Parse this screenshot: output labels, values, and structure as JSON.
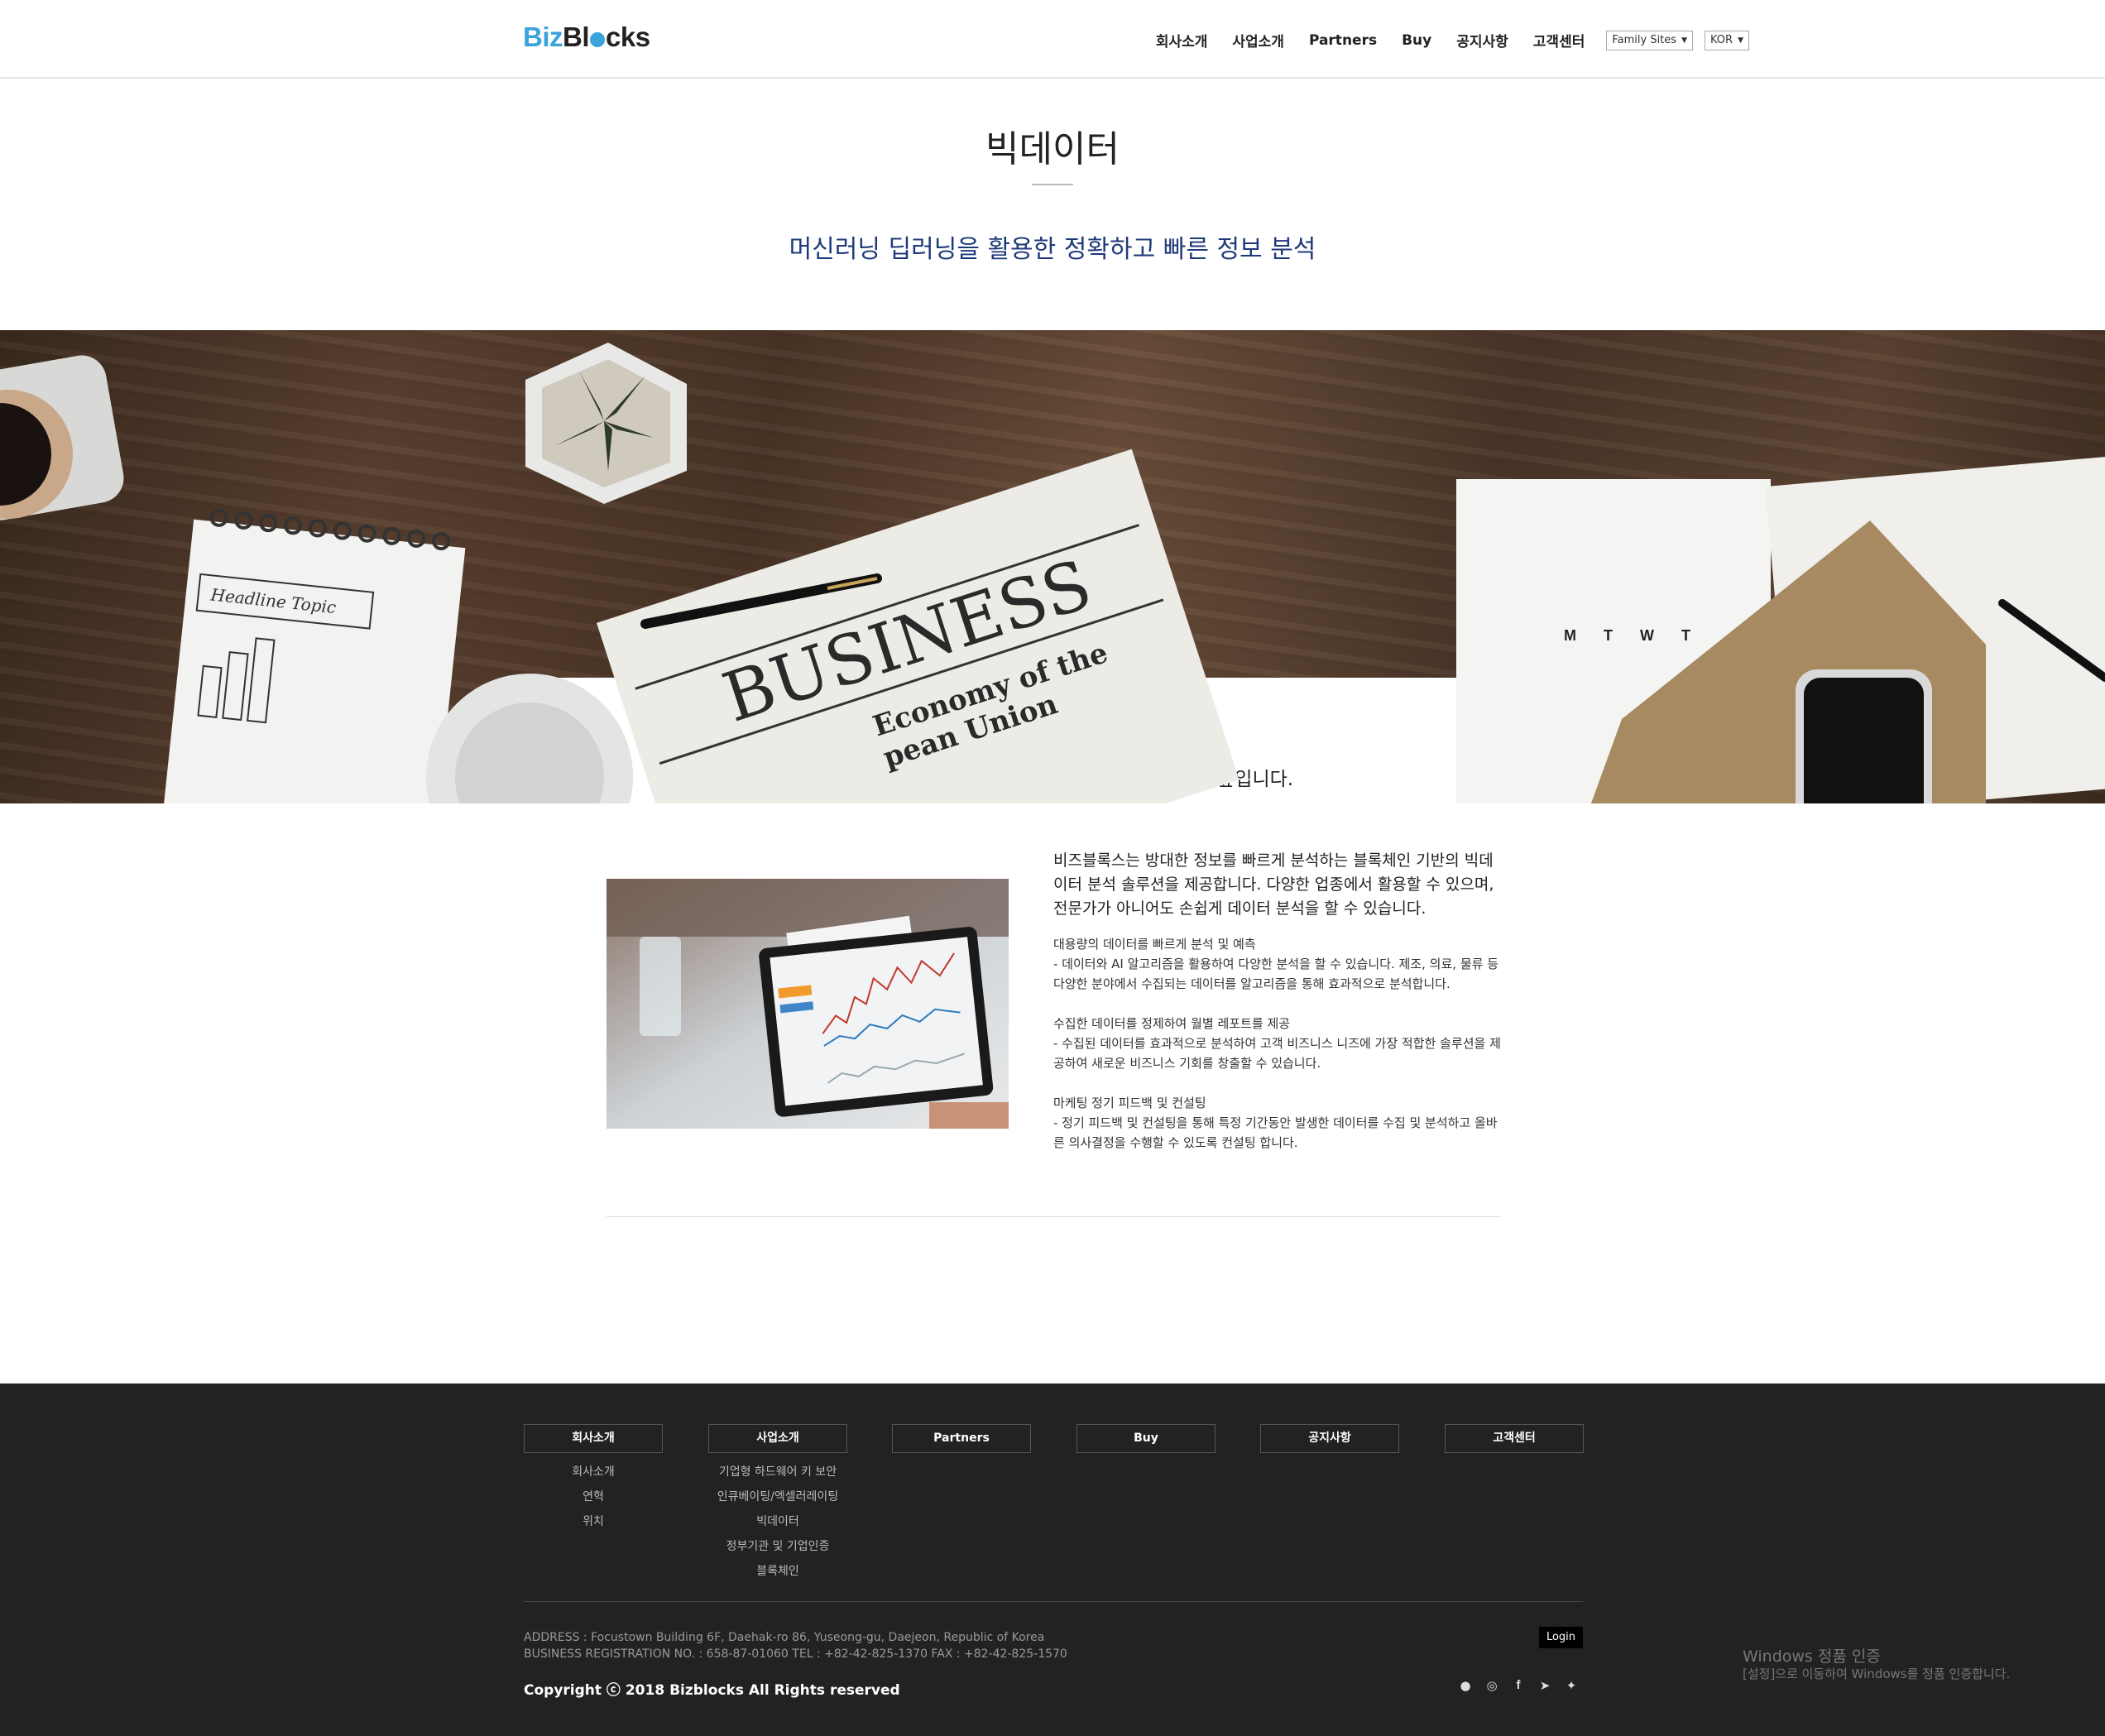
{
  "header": {
    "logo_biz": "Biz",
    "logo_bl": "Bl",
    "logo_cks": "cks",
    "nav": [
      "회사소개",
      "사업소개",
      "Partners",
      "Buy",
      "공지사항",
      "고객센터"
    ],
    "family_sites": "Family Sites",
    "language": "KOR",
    "caret": "▼"
  },
  "page": {
    "title": "빅데이터",
    "subtitle": "머신러닝 딥러닝을 활용한 정확하고 빠른 정보 분석"
  },
  "hero": {
    "lead": "대용량 데이터를 신속하게 처리하여 업무 효율성을 높입니다.",
    "newspaper_headline": "BUSINESS",
    "newspaper_sub1": "Economy of the",
    "newspaper_sub2": "pean Union",
    "notebook_text": "Headline  Topic",
    "calendar": "M T W T"
  },
  "content": {
    "intro": "비즈블록스는 방대한 정보를 빠르게 분석하는 블록체인 기반의 빅데이터 분석 솔루션을 제공합니다. 다양한 업종에서 활용할 수 있으며, 전문가가 아니어도 손쉽게 데이터 분석을 할 수 있습니다.",
    "items": [
      {
        "title": "대용량의 데이터를 빠르게 분석 및 예측",
        "desc": "- 데이터와 AI 알고리즘을 활용하여 다양한 분석을 할 수 있습니다. 제조, 의료, 물류 등 다양한 분야에서 수집되는 데이터를 알고리즘을 통해 효과적으로 분석합니다."
      },
      {
        "title": "수집한 데이터를 정제하여 월별 레포트를 제공",
        "desc": "- 수집된 데이터를 효과적으로 분석하여 고객 비즈니스 니즈에 가장 적합한 솔루션을 제공하여 새로운 비즈니스 기회를 창출할 수 있습니다."
      },
      {
        "title": "마케팅 정기 피드백 및 컨설팅",
        "desc": "- 정기 피드백 및 컨설팅을 통해 특정 기간동안 발생한 데이터를 수집 및 분석하고 올바른 의사결정을 수행할 수 있도록 컨설팅 합니다."
      }
    ]
  },
  "footer": {
    "columns": [
      {
        "head": "회사소개",
        "items": [
          "회사소개",
          "연혁",
          "위치"
        ]
      },
      {
        "head": "사업소개",
        "items": [
          "기업형 하드웨어 키 보안",
          "인큐베이팅/엑셀러레이팅",
          "빅데이터",
          "정부기관 및 기업인증",
          "블록체인"
        ]
      },
      {
        "head": "Partners",
        "items": []
      },
      {
        "head": "Buy",
        "items": []
      },
      {
        "head": "공지사항",
        "items": []
      },
      {
        "head": "고객센터",
        "items": []
      }
    ],
    "address": "ADDRESS : Focustown Building 6F, Daehak-ro 86, Yuseong-gu, Daejeon, Republic of Korea",
    "business": "BUSINESS REGISTRATION NO. : 658-87-01060 TEL : +82-42-825-1370 FAX : +82-42-825-1570",
    "copyright": "Copyright ⓒ 2018 Bizblocks All Rights reserved",
    "login": "Login",
    "social_icons": [
      "chat-icon",
      "instagram-icon",
      "facebook-icon",
      "telegram-icon",
      "twitter-icon"
    ]
  },
  "windows_watermark": {
    "title": "Windows 정품 인증",
    "sub": "[설정]으로 이동하여 Windows를 정품 인증합니다."
  }
}
